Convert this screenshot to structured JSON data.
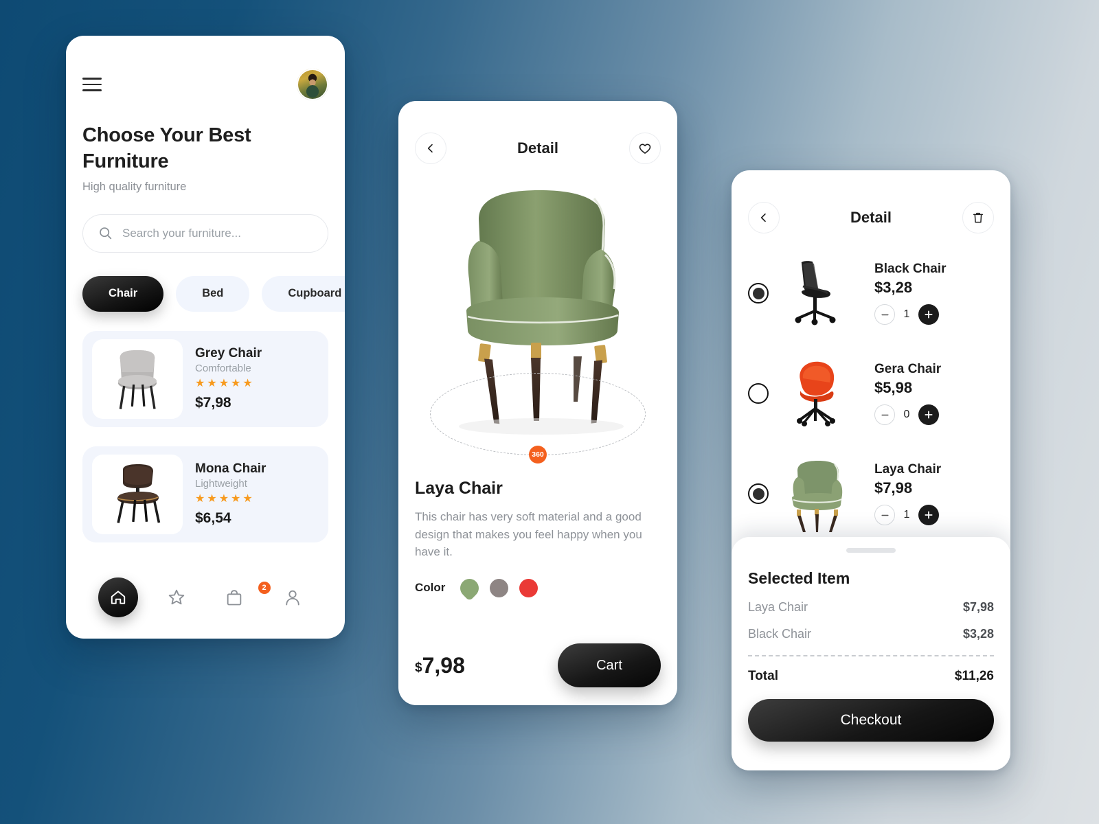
{
  "theme": {
    "bg_dark": "#0e4a73",
    "bg_light": "#dde1e4",
    "accent_orange": "#f4601e",
    "star_color": "#f79a1e",
    "card_bg": "#f2f5fc",
    "dark_button": "#141414"
  },
  "home": {
    "menu_icon": "hamburger-icon",
    "avatar": "user-avatar",
    "title": "Choose Your Best Furniture",
    "subtitle": "High quality furniture",
    "search": {
      "icon": "search-icon",
      "placeholder": "Search your furniture...",
      "value": ""
    },
    "categories": [
      {
        "label": "Chair",
        "active": true
      },
      {
        "label": "Bed",
        "active": false
      },
      {
        "label": "Cupboard",
        "active": false
      }
    ],
    "products": [
      {
        "name": "Grey Chair",
        "tag": "Comfortable",
        "stars": "★★★★★",
        "price": "$7,98"
      },
      {
        "name": "Mona Chair",
        "tag": "Lightweight",
        "stars": "★★★★★",
        "price": "$6,54"
      }
    ],
    "nav": [
      {
        "name": "home-icon",
        "active": true,
        "badge": ""
      },
      {
        "name": "star-icon",
        "active": false,
        "badge": ""
      },
      {
        "name": "bag-icon",
        "active": false,
        "badge": "2"
      },
      {
        "name": "person-icon",
        "active": false,
        "badge": ""
      }
    ]
  },
  "detail": {
    "back_icon": "chevron-left-icon",
    "title": "Detail",
    "favorite_icon": "heart-icon",
    "badge_360": "360",
    "product_name": "Laya Chair",
    "description": "This chair has very soft material and a good design that makes you feel happy when you have it.",
    "color_label": "Color",
    "colors": [
      {
        "name": "green",
        "hex": "#8ba874",
        "selected": true
      },
      {
        "name": "grey",
        "hex": "#8e8584",
        "selected": false
      },
      {
        "name": "red",
        "hex": "#ea3a36",
        "selected": false
      }
    ],
    "currency": "$",
    "price": "7,98",
    "cart_button": "Cart"
  },
  "cart": {
    "back_icon": "chevron-left-icon",
    "title": "Detail",
    "delete_icon": "trash-icon",
    "items": [
      {
        "name": "Black Chair",
        "price": "$3,28",
        "qty": "1",
        "selected": true,
        "image": "black-office-chair"
      },
      {
        "name": "Gera Chair",
        "price": "$5,98",
        "qty": "0",
        "selected": false,
        "image": "orange-swivel-chair"
      },
      {
        "name": "Laya Chair",
        "price": "$7,98",
        "qty": "1",
        "selected": true,
        "image": "green-armchair"
      }
    ],
    "sheet": {
      "title": "Selected Item",
      "lines": [
        {
          "name": "Laya Chair",
          "value": "$7,98"
        },
        {
          "name": "Black Chair",
          "value": "$3,28"
        }
      ],
      "total_label": "Total",
      "total_value": "$11,26",
      "checkout_label": "Checkout"
    }
  }
}
